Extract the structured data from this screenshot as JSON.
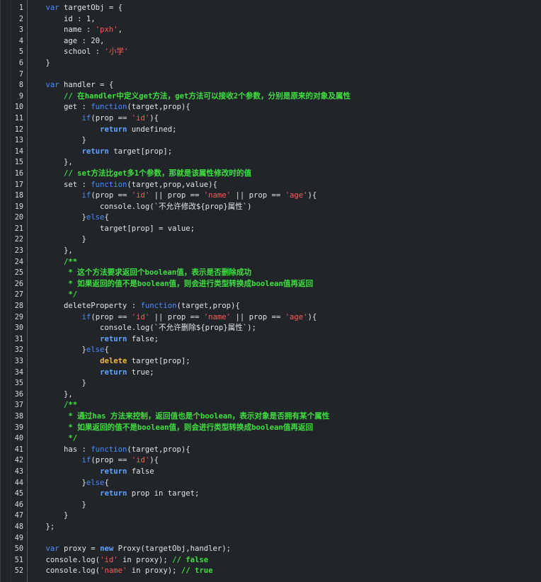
{
  "colors": {
    "background": "#21252a",
    "text": "#e1e4e8",
    "keyword": "#4a8cff",
    "string": "#ff5b56",
    "comment": "#3ee03e",
    "delete_keyword": "#f2b73f"
  },
  "lines": [
    {
      "n": "1",
      "tokens": [
        [
          "pl",
          "    "
        ],
        [
          "kw",
          "var"
        ],
        [
          "pl",
          " targetObj = {"
        ]
      ]
    },
    {
      "n": "2",
      "tokens": [
        [
          "pl",
          "        id : 1,"
        ]
      ]
    },
    {
      "n": "3",
      "tokens": [
        [
          "pl",
          "        name : "
        ],
        [
          "str",
          "'pxh'"
        ],
        [
          "pl",
          ","
        ]
      ]
    },
    {
      "n": "4",
      "tokens": [
        [
          "pl",
          "        age : 20,"
        ]
      ]
    },
    {
      "n": "5",
      "tokens": [
        [
          "pl",
          "        school : "
        ],
        [
          "str",
          "'小学'"
        ]
      ]
    },
    {
      "n": "6",
      "tokens": [
        [
          "pl",
          "    }"
        ]
      ]
    },
    {
      "n": "7",
      "tokens": [
        [
          "pl",
          ""
        ]
      ]
    },
    {
      "n": "8",
      "tokens": [
        [
          "pl",
          "    "
        ],
        [
          "kw",
          "var"
        ],
        [
          "pl",
          " handler = {"
        ]
      ]
    },
    {
      "n": "9",
      "tokens": [
        [
          "pl",
          "        "
        ],
        [
          "cm",
          "// 在handler中定义get方法，get方法可以接收2个参数，分别是原来的对象及属性"
        ]
      ]
    },
    {
      "n": "10",
      "tokens": [
        [
          "pl",
          "        get : "
        ],
        [
          "kw",
          "function"
        ],
        [
          "pl",
          "(target,prop){"
        ]
      ]
    },
    {
      "n": "11",
      "tokens": [
        [
          "pl",
          "            "
        ],
        [
          "kw",
          "if"
        ],
        [
          "pl",
          "(prop == "
        ],
        [
          "str",
          "'id'"
        ],
        [
          "pl",
          "){"
        ]
      ]
    },
    {
      "n": "12",
      "tokens": [
        [
          "pl",
          "                "
        ],
        [
          "kw2",
          "return"
        ],
        [
          "pl",
          " undefined;"
        ]
      ]
    },
    {
      "n": "13",
      "tokens": [
        [
          "pl",
          "            }"
        ]
      ]
    },
    {
      "n": "14",
      "tokens": [
        [
          "pl",
          "            "
        ],
        [
          "kw2",
          "return"
        ],
        [
          "pl",
          " target[prop];"
        ]
      ]
    },
    {
      "n": "15",
      "tokens": [
        [
          "pl",
          "        },"
        ]
      ]
    },
    {
      "n": "16",
      "tokens": [
        [
          "pl",
          "        "
        ],
        [
          "cm",
          "// set方法比get多1个参数，那就是该属性修改时的值"
        ]
      ]
    },
    {
      "n": "17",
      "tokens": [
        [
          "pl",
          "        set : "
        ],
        [
          "kw",
          "function"
        ],
        [
          "pl",
          "(target,prop,value){"
        ]
      ]
    },
    {
      "n": "18",
      "tokens": [
        [
          "pl",
          "            "
        ],
        [
          "kw",
          "if"
        ],
        [
          "pl",
          "(prop == "
        ],
        [
          "str",
          "'id'"
        ],
        [
          "pl",
          " || prop == "
        ],
        [
          "str",
          "'name'"
        ],
        [
          "pl",
          " || prop == "
        ],
        [
          "str",
          "'age'"
        ],
        [
          "pl",
          "){"
        ]
      ]
    },
    {
      "n": "19",
      "tokens": [
        [
          "pl",
          "                console.log(`不允许修改${prop}属性`)"
        ]
      ]
    },
    {
      "n": "20",
      "tokens": [
        [
          "pl",
          "            }"
        ],
        [
          "kw",
          "else"
        ],
        [
          "pl",
          "{"
        ]
      ]
    },
    {
      "n": "21",
      "tokens": [
        [
          "pl",
          "                target[prop] = value;"
        ]
      ]
    },
    {
      "n": "22",
      "tokens": [
        [
          "pl",
          "            }"
        ]
      ]
    },
    {
      "n": "23",
      "tokens": [
        [
          "pl",
          "        },"
        ]
      ]
    },
    {
      "n": "24",
      "tokens": [
        [
          "pl",
          "        "
        ],
        [
          "cm",
          "/**"
        ]
      ]
    },
    {
      "n": "25",
      "tokens": [
        [
          "pl",
          "         "
        ],
        [
          "cm",
          "* 这个方法要求返回个boolean值，表示是否删除成功"
        ]
      ]
    },
    {
      "n": "26",
      "tokens": [
        [
          "pl",
          "         "
        ],
        [
          "cm",
          "* 如果返回的值不是boolean值，则会进行类型转换成boolean值再返回"
        ]
      ]
    },
    {
      "n": "27",
      "tokens": [
        [
          "pl",
          "         "
        ],
        [
          "cm",
          "*/"
        ]
      ]
    },
    {
      "n": "28",
      "tokens": [
        [
          "pl",
          "        deleteProperty : "
        ],
        [
          "kw",
          "function"
        ],
        [
          "pl",
          "(target,prop){"
        ]
      ]
    },
    {
      "n": "29",
      "tokens": [
        [
          "pl",
          "            "
        ],
        [
          "kw",
          "if"
        ],
        [
          "pl",
          "(prop == "
        ],
        [
          "str",
          "'id'"
        ],
        [
          "pl",
          " || prop == "
        ],
        [
          "str",
          "'name'"
        ],
        [
          "pl",
          " || prop == "
        ],
        [
          "str",
          "'age'"
        ],
        [
          "pl",
          "){"
        ]
      ]
    },
    {
      "n": "30",
      "tokens": [
        [
          "pl",
          "                console.log(`不允许删除${prop}属性`);"
        ]
      ]
    },
    {
      "n": "31",
      "tokens": [
        [
          "pl",
          "                "
        ],
        [
          "kw2",
          "return"
        ],
        [
          "pl",
          " false;"
        ]
      ]
    },
    {
      "n": "32",
      "tokens": [
        [
          "pl",
          "            }"
        ],
        [
          "kw",
          "else"
        ],
        [
          "pl",
          "{"
        ]
      ]
    },
    {
      "n": "33",
      "tokens": [
        [
          "pl",
          "                "
        ],
        [
          "del",
          "delete"
        ],
        [
          "pl",
          " target[prop];"
        ]
      ]
    },
    {
      "n": "34",
      "tokens": [
        [
          "pl",
          "                "
        ],
        [
          "kw2",
          "return"
        ],
        [
          "pl",
          " true;"
        ]
      ]
    },
    {
      "n": "35",
      "tokens": [
        [
          "pl",
          "            }"
        ]
      ]
    },
    {
      "n": "36",
      "tokens": [
        [
          "pl",
          "        },"
        ]
      ]
    },
    {
      "n": "37",
      "tokens": [
        [
          "pl",
          "        "
        ],
        [
          "cm",
          "/**"
        ]
      ]
    },
    {
      "n": "38",
      "tokens": [
        [
          "pl",
          "         "
        ],
        [
          "cm",
          "* 通过has 方法来控制，返回值也是个boolean，表示对象是否拥有某个属性"
        ]
      ]
    },
    {
      "n": "39",
      "tokens": [
        [
          "pl",
          "         "
        ],
        [
          "cm",
          "* 如果返回的值不是boolean值，则会进行类型转换成boolean值再返回"
        ]
      ]
    },
    {
      "n": "40",
      "tokens": [
        [
          "pl",
          "         "
        ],
        [
          "cm",
          "*/"
        ]
      ]
    },
    {
      "n": "41",
      "tokens": [
        [
          "pl",
          "        has : "
        ],
        [
          "kw",
          "function"
        ],
        [
          "pl",
          "(target,prop){"
        ]
      ]
    },
    {
      "n": "42",
      "tokens": [
        [
          "pl",
          "            "
        ],
        [
          "kw",
          "if"
        ],
        [
          "pl",
          "(prop == "
        ],
        [
          "str",
          "'id'"
        ],
        [
          "pl",
          "){"
        ]
      ]
    },
    {
      "n": "43",
      "tokens": [
        [
          "pl",
          "                "
        ],
        [
          "kw2",
          "return"
        ],
        [
          "pl",
          " false"
        ]
      ]
    },
    {
      "n": "44",
      "tokens": [
        [
          "pl",
          "            }"
        ],
        [
          "kw",
          "else"
        ],
        [
          "pl",
          "{"
        ]
      ]
    },
    {
      "n": "45",
      "tokens": [
        [
          "pl",
          "                "
        ],
        [
          "kw2",
          "return"
        ],
        [
          "pl",
          " prop in target;"
        ]
      ]
    },
    {
      "n": "46",
      "tokens": [
        [
          "pl",
          "            }"
        ]
      ]
    },
    {
      "n": "47",
      "tokens": [
        [
          "pl",
          "        }"
        ]
      ]
    },
    {
      "n": "48",
      "tokens": [
        [
          "pl",
          "    };"
        ]
      ]
    },
    {
      "n": "49",
      "tokens": [
        [
          "pl",
          ""
        ]
      ]
    },
    {
      "n": "50",
      "tokens": [
        [
          "pl",
          "    "
        ],
        [
          "kw",
          "var"
        ],
        [
          "pl",
          " proxy = "
        ],
        [
          "kw2",
          "new"
        ],
        [
          "pl",
          " Proxy(targetObj,handler);"
        ]
      ]
    },
    {
      "n": "51",
      "tokens": [
        [
          "pl",
          "    console.log("
        ],
        [
          "str",
          "'id'"
        ],
        [
          "pl",
          " in proxy); "
        ],
        [
          "cm",
          "// false"
        ]
      ]
    },
    {
      "n": "52",
      "tokens": [
        [
          "pl",
          "    console.log("
        ],
        [
          "str",
          "'name'"
        ],
        [
          "pl",
          " in proxy); "
        ],
        [
          "cm",
          "// true"
        ]
      ]
    }
  ]
}
